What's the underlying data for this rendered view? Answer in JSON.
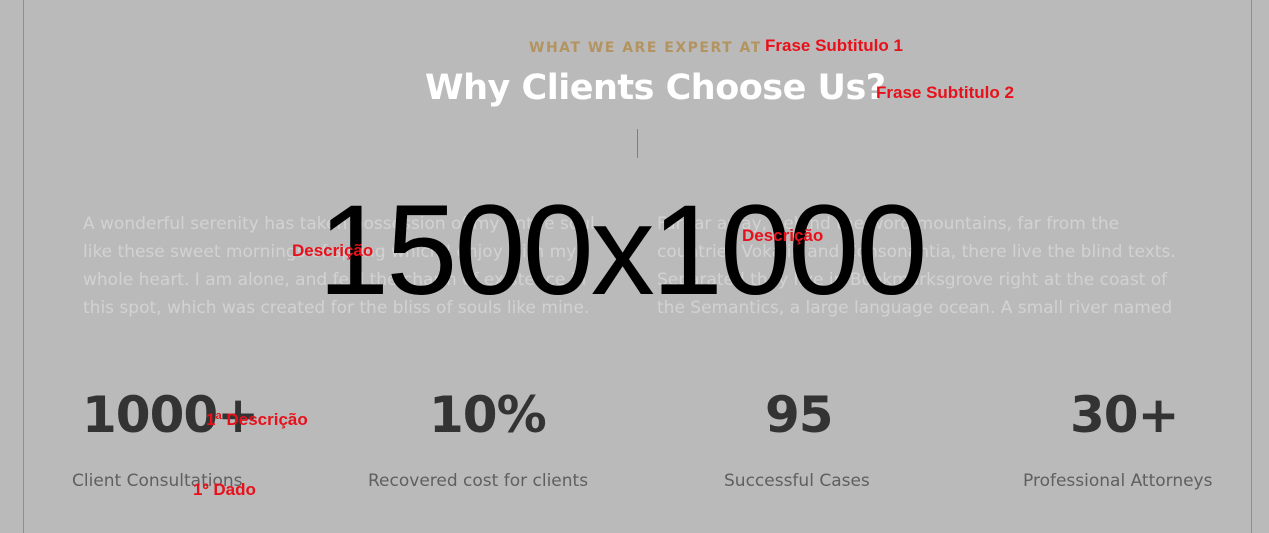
{
  "header": {
    "eyebrow": "WHAT WE ARE EXPERT AT",
    "title": "Why Clients Choose Us?"
  },
  "paragraphs": {
    "left": "A wonderful serenity has taken possession of my entire soul, like these sweet mornings of spring which I enjoy with my whole heart. I am alone, and feel the charm of existence in this spot, which was created for the bliss of souls like mine.",
    "right": "Far far away, behind the word mountains, far from the countries Vokalia and Consonantia, there live the blind texts. Separated they live in Bookmarksgrove right at the coast of the Semantics, a large language ocean. A small river named"
  },
  "placeholder_overlay": "1500x1000",
  "stats": [
    {
      "value": "1000+",
      "label": "Client Consultations"
    },
    {
      "value": "10%",
      "label": "Recovered cost for clients"
    },
    {
      "value": "95",
      "label": "Successful Cases"
    },
    {
      "value": "30+",
      "label": "Professional Attorneys"
    }
  ],
  "annotations": {
    "subtitle1": "Frase Subtitulo 1",
    "subtitle2": "Frase Subtitulo 2",
    "desc_left": "Descrição",
    "desc_right": "Descrição",
    "stat_desc": "1ª Descrição",
    "stat_data": "1º Dado"
  },
  "colors": {
    "background": "#bababa",
    "eyebrow": "#b39461",
    "annotation": "#e8101a",
    "stat_number": "#333333"
  }
}
